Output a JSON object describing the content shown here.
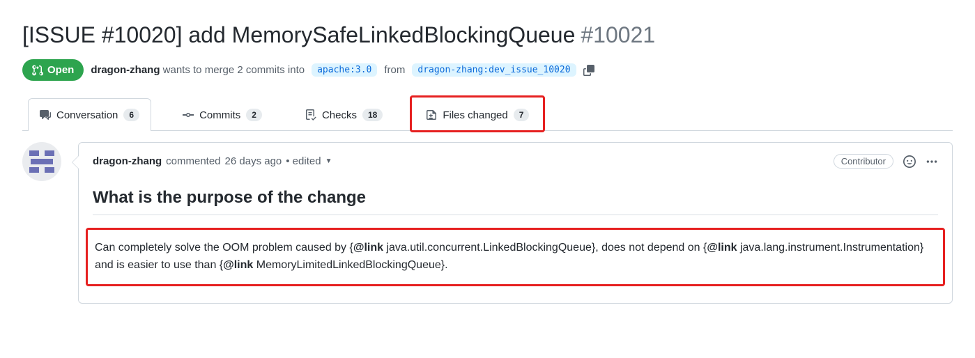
{
  "title": {
    "text": "[ISSUE #10020] add MemorySafeLinkedBlockingQueue",
    "number": "#10021"
  },
  "state": {
    "label": "Open"
  },
  "merge": {
    "author": "dragon-zhang",
    "wants_prefix": " wants to merge ",
    "commit_count": "2",
    "commits_word": " commits into ",
    "base_branch": "apache:3.0",
    "from_word": " from ",
    "head_branch": "dragon-zhang:dev_issue_10020"
  },
  "tabs": {
    "conversation": {
      "label": "Conversation",
      "count": "6"
    },
    "commits": {
      "label": "Commits",
      "count": "2"
    },
    "checks": {
      "label": "Checks",
      "count": "18"
    },
    "files": {
      "label": "Files changed",
      "count": "7"
    }
  },
  "comment": {
    "author": "dragon-zhang",
    "commented_word": " commented ",
    "timestamp": "26 days ago",
    "dot_edited": " • edited",
    "role": "Contributor",
    "section_heading": "What is the purpose of the change",
    "body": {
      "t1": "Can completely solve the OOM problem caused by {",
      "l1": "@link",
      "t2": " java.util.concurrent.LinkedBlockingQueue}, does not depend on {",
      "l2": "@link",
      "t3": " java.lang.instrument.Instrumentation} and is easier to use than {",
      "l3": "@link",
      "t4": " MemoryLimitedLinkedBlockingQueue}."
    }
  }
}
